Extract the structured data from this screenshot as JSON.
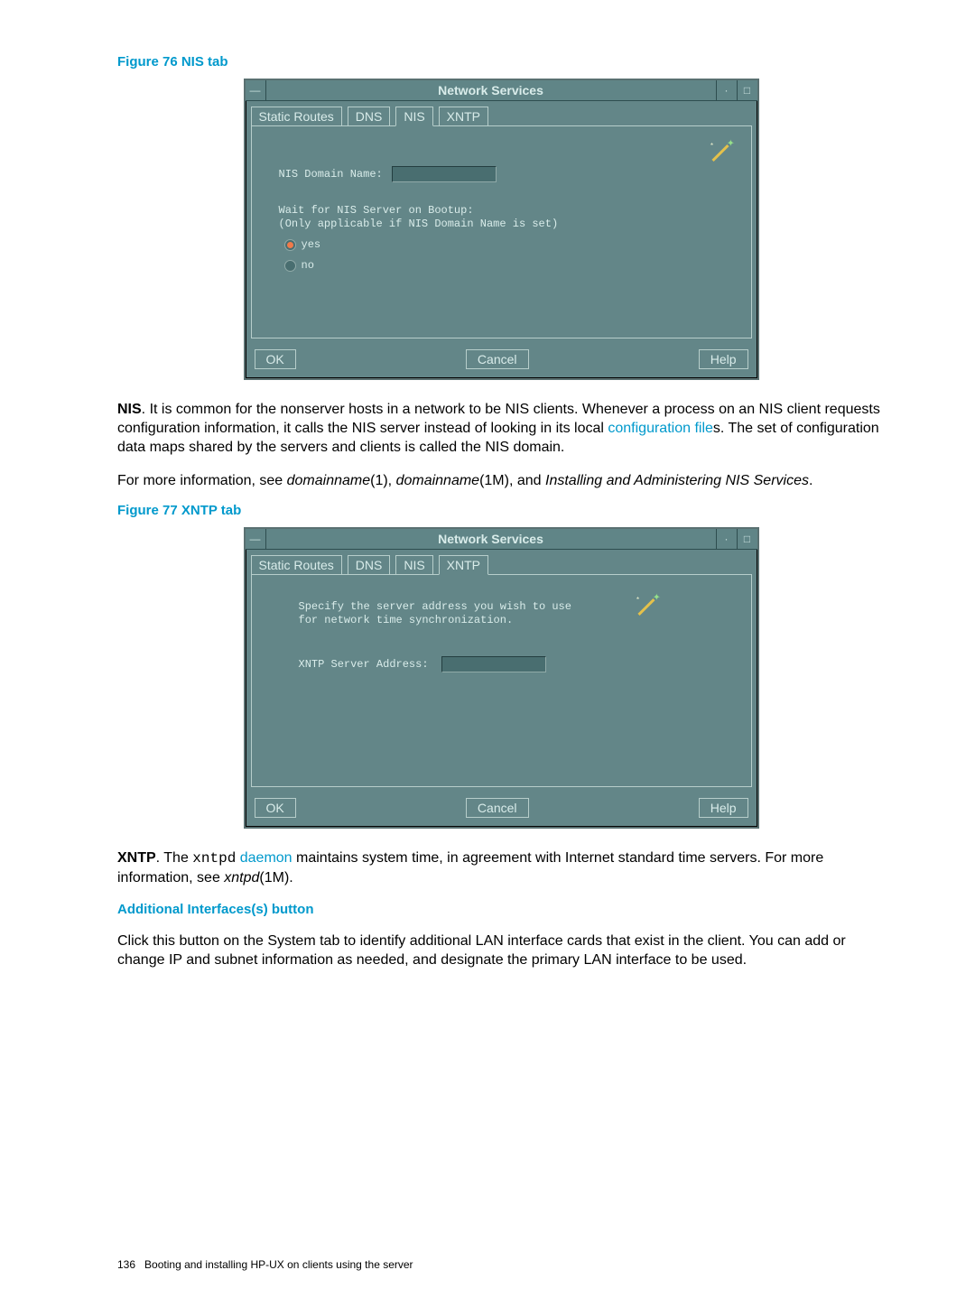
{
  "figure76": {
    "caption": "Figure 76 NIS tab",
    "window_title": "Network Services",
    "tabs": [
      "Static Routes",
      "DNS",
      "NIS",
      "XNTP"
    ],
    "active_tab": 2,
    "field_label": "NIS Domain Name:",
    "wait_line1": "Wait for NIS Server on Bootup:",
    "wait_line2": "(Only applicable if NIS Domain Name is set)",
    "opt_yes": "yes",
    "opt_no": "no",
    "btn_ok": "OK",
    "btn_cancel": "Cancel",
    "btn_help": "Help"
  },
  "nis_para": {
    "lead": "NIS",
    "text1": ". It is common for the nonserver hosts in a network to be NIS clients. Whenever a process on an NIS client requests configuration information, it calls the NIS server instead of looking in its local ",
    "link": "configuration file",
    "text2": "s. The set of configuration data maps shared by the servers and clients is called the NIS domain."
  },
  "nis_para2": {
    "t1": "For more information, see ",
    "i1": "domainname",
    "t2": "(1), ",
    "i2": "domainname",
    "t3": "(1M), and ",
    "i3": "Installing and Administering NIS Services",
    "t4": "."
  },
  "figure77": {
    "caption": "Figure 77 XNTP tab",
    "window_title": "Network Services",
    "tabs": [
      "Static Routes",
      "DNS",
      "NIS",
      "XNTP"
    ],
    "active_tab": 3,
    "desc_line1": "Specify the server address you wish to use",
    "desc_line2": "for network time synchronization.",
    "field_label": "XNTP Server Address:",
    "btn_ok": "OK",
    "btn_cancel": "Cancel",
    "btn_help": "Help"
  },
  "xntp_para": {
    "lead": "XNTP",
    "t1": ". The ",
    "mono": "xntpd",
    "link": " daemon",
    "t2": " maintains system time, in agreement with Internet standard time servers. For more information, see ",
    "i1": "xntpd",
    "t3": "(1M)."
  },
  "addl": {
    "heading": "Additional Interfaces(s) button",
    "para": "Click this button on the System tab to identify additional LAN interface cards that exist in the client. You can add or change IP and subnet information as needed, and designate the primary LAN interface to be used."
  },
  "footer": {
    "page": "136",
    "text": "Booting and installing HP-UX on clients using the server"
  }
}
